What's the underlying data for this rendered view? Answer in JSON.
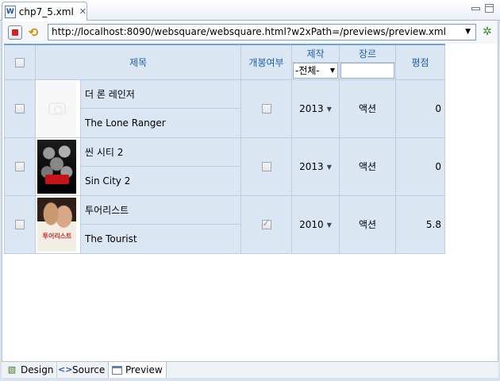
{
  "editor": {
    "tab_title": "chp7_5.xml",
    "tab_icon": "W"
  },
  "toolbar": {
    "url": "http://localhost:8090/websquare/websquare.html?w2xPath=/previews/preview.xml"
  },
  "grid": {
    "headers": {
      "title": "제목",
      "released": "개봉여부",
      "production": "제작",
      "genre": "장르",
      "rating": "평점"
    },
    "production_filter": "-전체-",
    "genre_filter": "",
    "rows": [
      {
        "title_ko": "더 론 레인저",
        "title_en": "The Lone Ranger",
        "released": false,
        "year": "2013",
        "genre": "액션",
        "rating": "0",
        "poster": "camera-placeholder"
      },
      {
        "title_ko": "씬 시티 2",
        "title_en": "Sin City 2",
        "released": false,
        "year": "2013",
        "genre": "액션",
        "rating": "0",
        "poster": "sin-city-poster"
      },
      {
        "title_ko": "투어리스트",
        "title_en": "The Tourist",
        "released": true,
        "year": "2010",
        "genre": "액션",
        "rating": "5.8",
        "poster": "tourist-poster",
        "poster_text": "투어리스트"
      }
    ]
  },
  "bottom_tabs": {
    "design": "Design",
    "source": "Source",
    "preview": "Preview",
    "active": "Preview"
  }
}
